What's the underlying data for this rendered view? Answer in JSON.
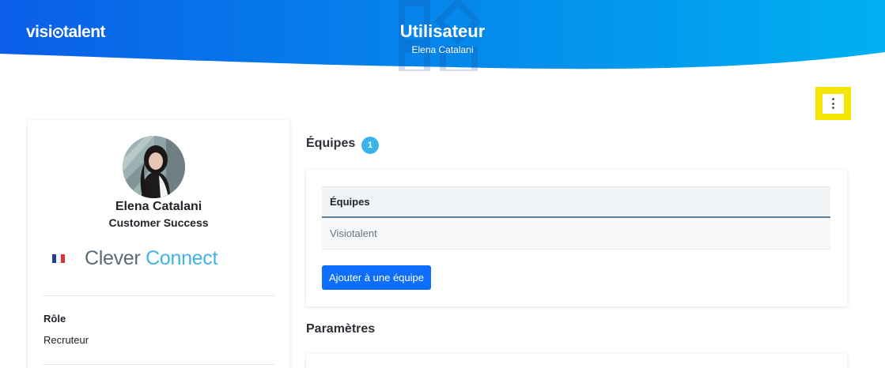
{
  "header": {
    "brand": {
      "prefix": "visi",
      "suffix": "talent"
    },
    "title": "Utilisateur",
    "subtitle": "Elena Catalani",
    "gradient_start": "#0a5ee8",
    "gradient_end": "#00b0f0"
  },
  "menu": {
    "icon": "more-vertical-icon",
    "highlight_color": "#f5e600"
  },
  "profile": {
    "name": "Elena Catalani",
    "job_title": "Customer Success",
    "country_flag": "france-flag-icon",
    "company_logo": {
      "word1": "Clever",
      "word2": "Connect"
    },
    "fields": [
      {
        "label": "Rôle",
        "value": "Recruteur"
      }
    ]
  },
  "teams": {
    "title": "Équipes",
    "count": "1",
    "table": {
      "column": "Équipes",
      "rows": [
        "Visiotalent"
      ]
    },
    "add_button": "Ajouter à une équipe"
  },
  "settings": {
    "title": "Paramètres"
  },
  "colors": {
    "primary_button": "#0d6efd",
    "badge": "#3ab4e8",
    "logo_grey": "#5d6b75",
    "logo_blue": "#3fb3e6"
  }
}
